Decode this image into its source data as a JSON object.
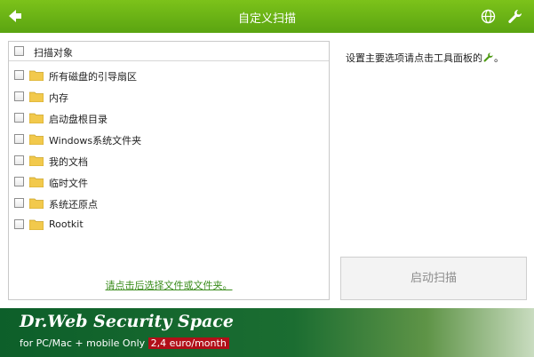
{
  "header": {
    "title": "自定义扫描",
    "back_icon": "back-arrow-icon",
    "globe_icon": "globe-icon",
    "wrench_icon": "wrench-icon"
  },
  "scan_panel": {
    "header_label": "扫描对象",
    "items": [
      {
        "label": "所有磁盘的引导扇区",
        "checked": false
      },
      {
        "label": "内存",
        "checked": false
      },
      {
        "label": "启动盘根目录",
        "checked": false
      },
      {
        "label": "Windows系统文件夹",
        "checked": false
      },
      {
        "label": "我的文档",
        "checked": false
      },
      {
        "label": "临时文件",
        "checked": false
      },
      {
        "label": "系统还原点",
        "checked": false
      },
      {
        "label": "Rootkit",
        "checked": false
      }
    ],
    "select_link": "请点击后选择文件或文件夹。"
  },
  "hint": {
    "text": "设置主要选项请点击工具面板的",
    "suffix": "。"
  },
  "start_button": {
    "label": "启动扫描"
  },
  "banner": {
    "title": "Dr.Web Security Space",
    "subtitle": "for PC/Mac + mobile Only",
    "price": "2,4 euro/month"
  },
  "colors": {
    "accent_green": "#6bb516",
    "link_green": "#3c8d1e",
    "banner_green": "#0d5f2a",
    "price_red": "#b10f18"
  }
}
